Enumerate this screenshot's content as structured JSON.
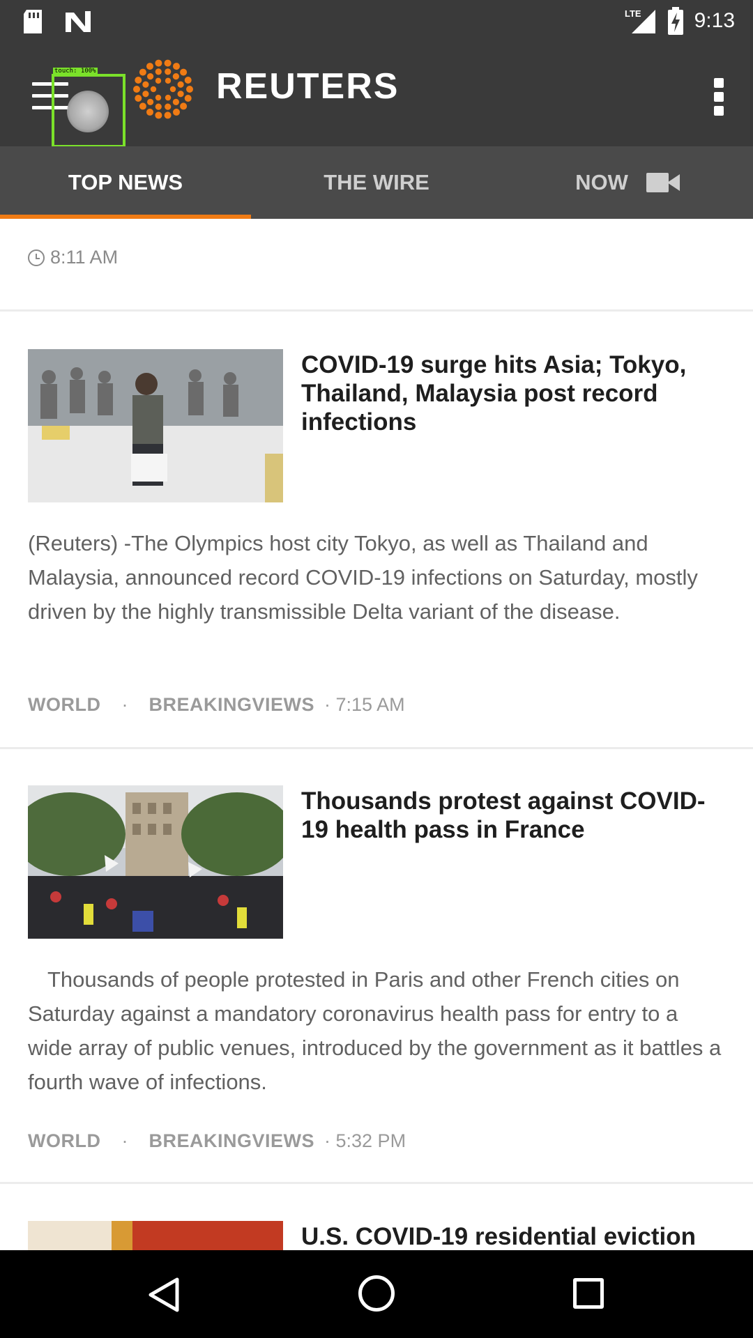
{
  "status_bar": {
    "time": "9:13",
    "network": "LTE",
    "icons": [
      "sd-card-icon",
      "n-notification-icon",
      "signal-icon",
      "battery-charging-icon"
    ]
  },
  "app_bar": {
    "logo_text": "REUTERS",
    "menu_icon": "menu-icon",
    "overflow_icon": "overflow-icon",
    "touch_label": "touch: 100%"
  },
  "tabs": [
    {
      "label": "TOP NEWS",
      "active": true
    },
    {
      "label": "THE WIRE",
      "active": false
    },
    {
      "label": "NOW",
      "active": false,
      "icon": "video-camera-icon"
    }
  ],
  "feed": {
    "partial_item_time": "8:11 AM",
    "articles": [
      {
        "headline": "COVID-19 surge hits Asia; Tokyo, Thailand, Malaysia post record infections",
        "summary": "(Reuters) -The Olympics host city Tokyo, as well as Thailand and Malaysia, announced record COVID-19 infections on Saturday, mostly driven by the highly transmissible Delta variant of the disease.",
        "tag1": "WORLD",
        "tag2": "BREAKINGVIEWS",
        "time": "· 7:15 AM"
      },
      {
        "headline": "Thousands protest against COVID-19 health pass in France",
        "summary": "Thousands of people protested in Paris and other French cities on Saturday against a mandatory coronavirus health pass for entry to a wide array of public venues, introduced by the government as it battles a fourth wave of infections.",
        "tag1": "WORLD",
        "tag2": "BREAKINGVIEWS",
        "time": "· 5:32 PM"
      },
      {
        "headline": "U.S. COVID-19 residential eviction"
      }
    ]
  },
  "colors": {
    "app_bar": "#3a3a3a",
    "tab_bar": "#4a4a4a",
    "accent": "#f07b14",
    "logo": "#f07b14"
  }
}
